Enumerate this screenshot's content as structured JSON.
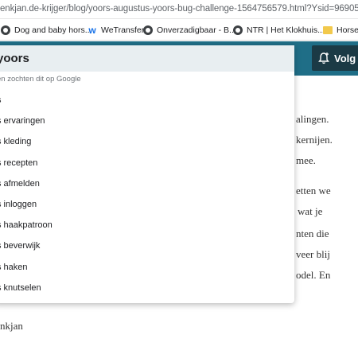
{
  "browser": {
    "address": "enkjan.de-krijger/blog/yoors-augustus-yoors-bug-challenge-1564756579.html?Ysid=96905",
    "bookmarks": [
      {
        "label": "Dog and baby hors...",
        "icon": "globe-icon"
      },
      {
        "label": "WeTransfer",
        "icon": "wetransfer-icon"
      },
      {
        "label": "Onverzadigbaar - B...",
        "icon": "globe-icon"
      },
      {
        "label": "NTR | Het Klokhuis...",
        "icon": "globe-icon"
      },
      {
        "label": "Horse",
        "icon": "folder-icon"
      }
    ]
  },
  "header": {
    "follow_label": "Volg",
    "color": "#1f6e87",
    "button_color": "#1b3a45"
  },
  "search": {
    "value": "yoors",
    "hint": "en zochten dit op Google",
    "suggestions": [
      "s",
      "s ervaringen",
      "s kleding",
      "s recepten",
      "s afmelden",
      "s inloggen",
      "s haakpatroon",
      "s beverwijk",
      "s haken",
      "s knutselen"
    ]
  },
  "article": {
    "fragments": [
      "alingen.",
      "kernijen.",
      "mee.",
      "etten we",
      "wat  je",
      "nten die",
      "veer blij",
      "odel. En"
    ],
    "signature": "nkjan"
  }
}
